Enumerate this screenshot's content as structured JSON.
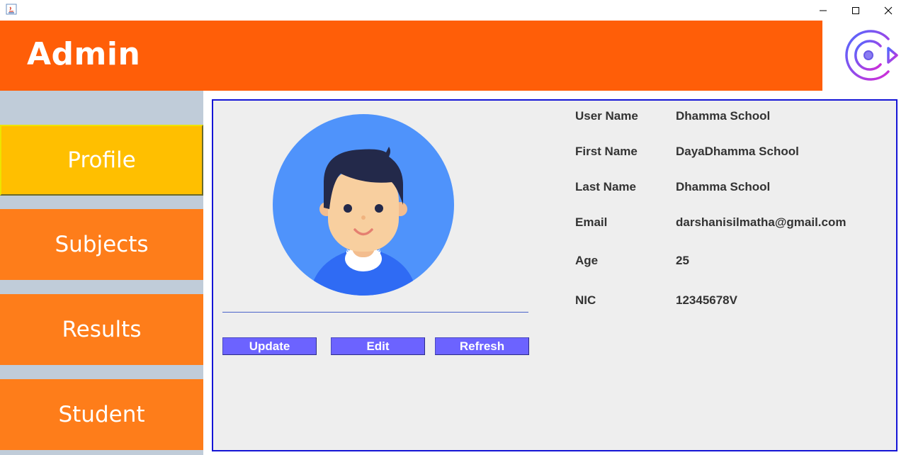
{
  "window": {
    "minimize_glyph": "—",
    "maximize_glyph": "☐",
    "close_glyph": "✕"
  },
  "header": {
    "title": "Admin"
  },
  "sidebar": {
    "items": [
      {
        "label": "Profile",
        "active": true
      },
      {
        "label": "Subjects",
        "active": false
      },
      {
        "label": "Results",
        "active": false
      },
      {
        "label": "Student",
        "active": false
      }
    ]
  },
  "profile": {
    "fields": [
      {
        "label": "User Name",
        "value": "Dhamma School"
      },
      {
        "label": "First Name",
        "value": "DayaDhamma School"
      },
      {
        "label": "Last Name",
        "value": "Dhamma School"
      },
      {
        "label": "Email",
        "value": "darshanisilmatha@gmail.com"
      },
      {
        "label": "Age",
        "value": "25"
      },
      {
        "label": "NIC",
        "value": "12345678V"
      }
    ]
  },
  "actions": {
    "update_label": "Update",
    "edit_label": "Edit",
    "refresh_label": "Refresh"
  },
  "colors": {
    "header_bg": "#ff5e08",
    "nav_bg": "#fe7d1a",
    "nav_active_bg": "#ffbf00",
    "sidebar_bg": "#c0ccd9",
    "button_bg": "#6c63ff",
    "panel_border": "#1414d6"
  },
  "icons": {
    "app": "java-icon",
    "logo": "logout-icon",
    "avatar": "user-avatar"
  }
}
